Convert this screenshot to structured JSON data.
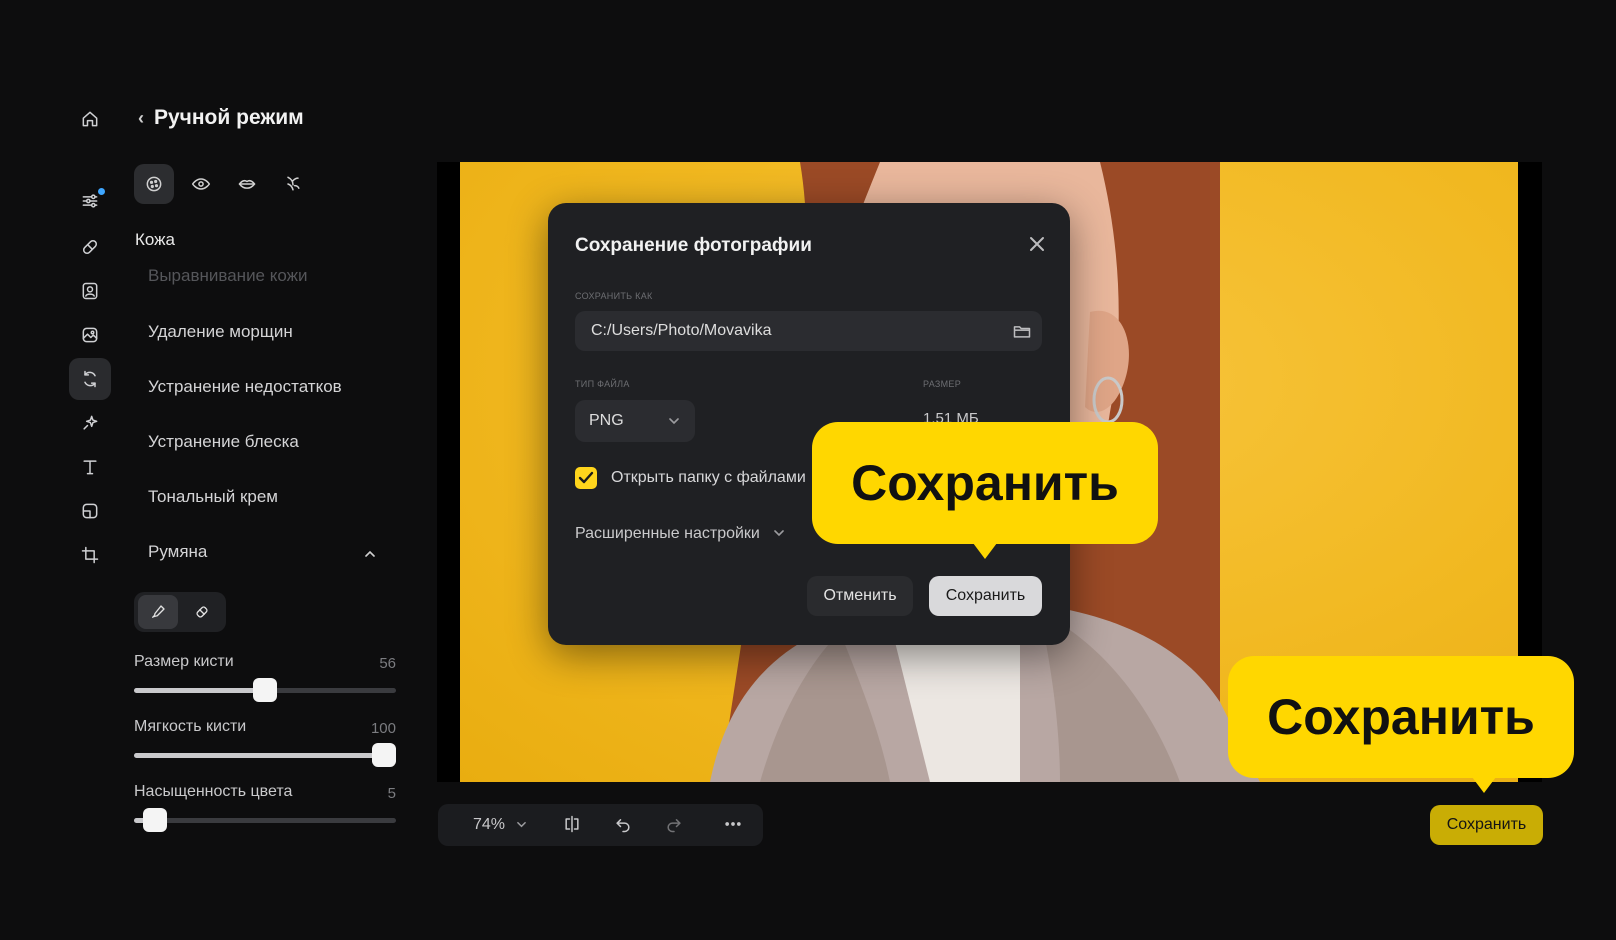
{
  "panel": {
    "back_title": "Ручной режим",
    "section": "Кожа",
    "faded_item": "Выравнивание кожи",
    "items": [
      "Удаление морщин",
      "Устранение недостатков",
      "Устранение блеска",
      "Тональный крем",
      "Румяна"
    ],
    "sliders": [
      {
        "label": "Размер кисти",
        "value": "56",
        "level": 0.5
      },
      {
        "label": "Мягкость кисти",
        "value": "100",
        "level": 1.0
      },
      {
        "label": "Насыщенность цвета",
        "value": "5",
        "level": 0.08
      }
    ]
  },
  "rail": {
    "icons": [
      "home-icon",
      "sliders-icon",
      "bandage-icon",
      "portrait-icon",
      "image-edit-icon",
      "retouch-icon",
      "magic-icon",
      "text-icon",
      "layout-icon",
      "crop-icon"
    ]
  },
  "dialog": {
    "title": "Сохранение фотографии",
    "save_as_label": "СОХРАНИТЬ КАК",
    "path": "C:/Users/Photo/Movavika",
    "file_type_label": "ТИП ФАЙЛА",
    "file_type": "PNG",
    "size_label": "РАЗМЕР",
    "size": "1,51 МБ",
    "open_folder_label": "Открыть папку с файлами",
    "open_folder_checked": true,
    "advanced_label": "Расширенные настройки",
    "cancel_label": "Отменить",
    "save_label": "Сохранить"
  },
  "callouts": {
    "dialog_save": "Сохранить",
    "main_save": "Сохранить"
  },
  "toolbar": {
    "zoom": "74%",
    "save_label": "Сохранить"
  },
  "colors": {
    "accent": "#ffd700",
    "background": "#0d0d0e",
    "photo_bg": "#f1b820"
  }
}
